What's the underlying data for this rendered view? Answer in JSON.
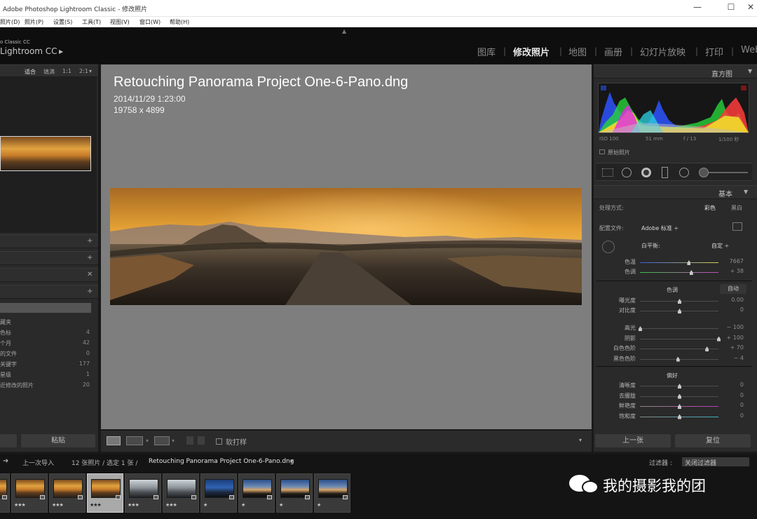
{
  "window": {
    "title": "Adobe Photoshop Lightroom Classic - 修改照片",
    "min": "—",
    "max": "☐",
    "close": "✕"
  },
  "menu": [
    "照片(D)",
    "照片(P)",
    "设置(S)",
    "工具(T)",
    "视图(V)",
    "窗口(W)",
    "帮助(H)"
  ],
  "identity": {
    "line1": "o Classic CC",
    "line2": "Lightroom CC",
    "play": "▶",
    "up_arrow": "▲"
  },
  "modules": [
    {
      "label": "图库",
      "active": false
    },
    {
      "label": "修改照片",
      "active": true
    },
    {
      "label": "地图",
      "active": false
    },
    {
      "label": "画册",
      "active": false
    },
    {
      "label": "幻灯片放映",
      "active": false
    },
    {
      "label": "打印",
      "active": false
    },
    {
      "label": "Web",
      "active": false
    }
  ],
  "navigator": {
    "zoom_options": [
      "适合",
      "填满",
      "1:1",
      "2:1"
    ],
    "zoom_dropdown": "▾"
  },
  "left_panel": {
    "plus": "+",
    "close": "✕",
    "collections": [
      {
        "label": "藏夹",
        "count": ""
      },
      {
        "label": "色标",
        "count": "4"
      },
      {
        "label": "个月",
        "count": "42"
      },
      {
        "label": "的文件",
        "count": "0"
      },
      {
        "label": "关键字",
        "count": "177"
      },
      {
        "label": "星级",
        "count": "1"
      },
      {
        "label": "近修改的照片",
        "count": "20"
      }
    ],
    "paste_button": "粘贴"
  },
  "photo": {
    "filename": "Retouching Panorama Project One-6-Pano.dng",
    "datetime": "2014/11/29 1:23:00",
    "dimensions": "19758 x 4899"
  },
  "toolbar": {
    "soft_proofing": "软打样",
    "dropdown": "▾"
  },
  "histogram": {
    "title": "直方图",
    "iso": "ISO 100",
    "focal": "51 mm",
    "aperture": "f / 13",
    "shutter": "1/100 秒",
    "original_photo": "原始照片",
    "colors": {
      "red": "#ff3b3b",
      "green": "#27d43a",
      "blue": "#2e54ff",
      "yellow": "#f2ee2a",
      "magenta": "#e42be6",
      "cyan": "#2bd6e4"
    }
  },
  "basic": {
    "title": "基本",
    "treatment_label": "处理方式:",
    "treatment_color": "彩色",
    "treatment_bw": "黑白",
    "profile_label": "配置文件:",
    "profile_value": "Adobe 标准 ÷",
    "wb_label": "白平衡:",
    "wb_value": "自定 ÷",
    "tone_label": "色调",
    "auto_button": "自动",
    "presence_label": "偏好",
    "sliders_wb": [
      {
        "label": "色温",
        "value": "7667",
        "pos": 0.62
      },
      {
        "label": "色调",
        "value": "+ 38",
        "pos": 0.65
      }
    ],
    "sliders_tone": [
      {
        "label": "曝光度",
        "value": "0.00",
        "pos": 0.5
      },
      {
        "label": "对比度",
        "value": "0",
        "pos": 0.5
      }
    ],
    "sliders_tone2": [
      {
        "label": "高光",
        "value": "− 100",
        "pos": 0.0
      },
      {
        "label": "阴影",
        "value": "+ 100",
        "pos": 1.0
      },
      {
        "label": "白色色阶",
        "value": "+ 70",
        "pos": 0.85
      },
      {
        "label": "黑色色阶",
        "value": "− 4",
        "pos": 0.48
      }
    ],
    "sliders_presence": [
      {
        "label": "清晰度",
        "value": "0",
        "pos": 0.5
      },
      {
        "label": "去朦胧",
        "value": "0",
        "pos": 0.5
      },
      {
        "label": "鲜艳度",
        "value": "0",
        "pos": 0.5
      },
      {
        "label": "饱和度",
        "value": "0",
        "pos": 0.5
      }
    ]
  },
  "right_buttons": {
    "previous": "上一张",
    "reset": "复位"
  },
  "filmstrip_bar": {
    "breadcrumb_prefix": "上一次导入",
    "count_text": "12 张照片 / 选定 1 张 /",
    "selected_file": "Retouching Panorama Project One-6-Pano.dng",
    "dropdown": "▾",
    "filter_label": "过滤器 :",
    "filter_value": "关闭过滤器",
    "arrow": "➜"
  },
  "thumbnails": [
    {
      "stars": "★★★",
      "style": "sunset",
      "selected": false
    },
    {
      "stars": "★★★",
      "style": "sunset",
      "selected": false
    },
    {
      "stars": "★★★",
      "style": "sunset",
      "selected": false
    },
    {
      "stars": "★★★",
      "style": "sunset",
      "selected": true
    },
    {
      "stars": "★★★",
      "style": "dusk",
      "selected": false
    },
    {
      "stars": "★★★",
      "style": "dusk",
      "selected": false
    },
    {
      "stars": "★",
      "style": "blue",
      "selected": false
    },
    {
      "stars": "★",
      "style": "bluesun",
      "selected": false
    },
    {
      "stars": "★",
      "style": "bluesun",
      "selected": false
    },
    {
      "stars": "★",
      "style": "bluesun",
      "selected": false
    }
  ],
  "watermark": {
    "text": "我的摄影我的团"
  }
}
